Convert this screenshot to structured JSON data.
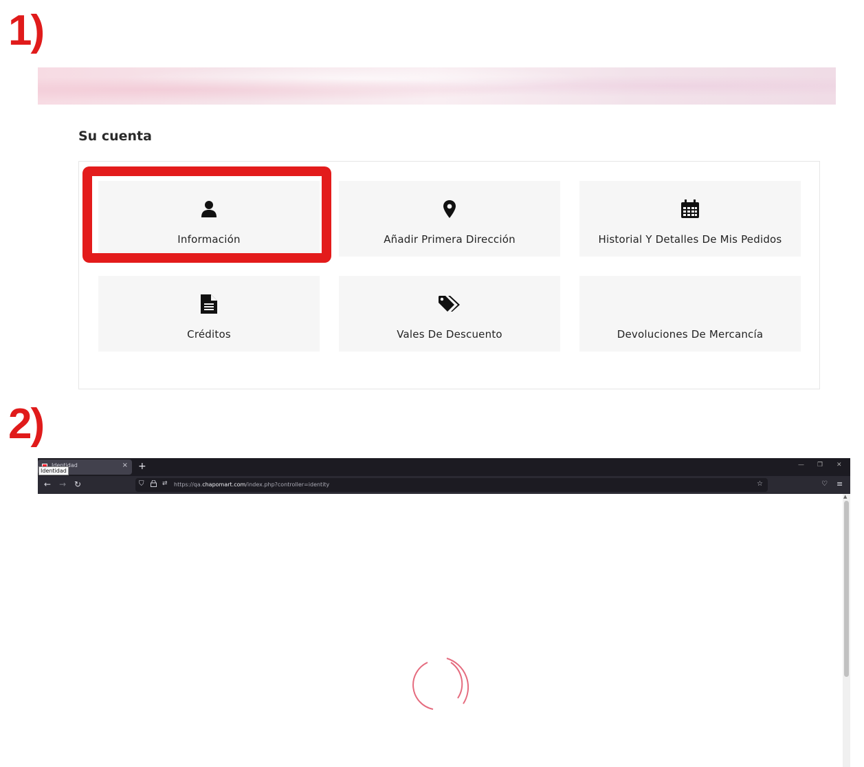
{
  "steps": {
    "first": "1)",
    "second": "2)"
  },
  "account": {
    "title": "Su cuenta",
    "tiles": [
      {
        "label": "Información",
        "icon": "user-icon"
      },
      {
        "label": "Añadir Primera Dirección",
        "icon": "map-pin-icon"
      },
      {
        "label": "Historial Y Detalles De Mis Pedidos",
        "icon": "calendar-icon"
      },
      {
        "label": "Créditos",
        "icon": "document-icon"
      },
      {
        "label": "Vales De Descuento",
        "icon": "tags-icon"
      },
      {
        "label": "Devoluciones De Mercancía",
        "icon": ""
      }
    ],
    "highlight_color": "#e31b1b"
  },
  "browser": {
    "tab_title": "Identidad",
    "tab_tooltip": "Identidad",
    "new_tab": "+",
    "close_tab": "×",
    "url_prefix": "https://qa.",
    "url_domain": "chapomart.com",
    "url_path": "/index.php?controller=identity",
    "spinner_color": "#e56b7e",
    "loading_state": "loading"
  }
}
